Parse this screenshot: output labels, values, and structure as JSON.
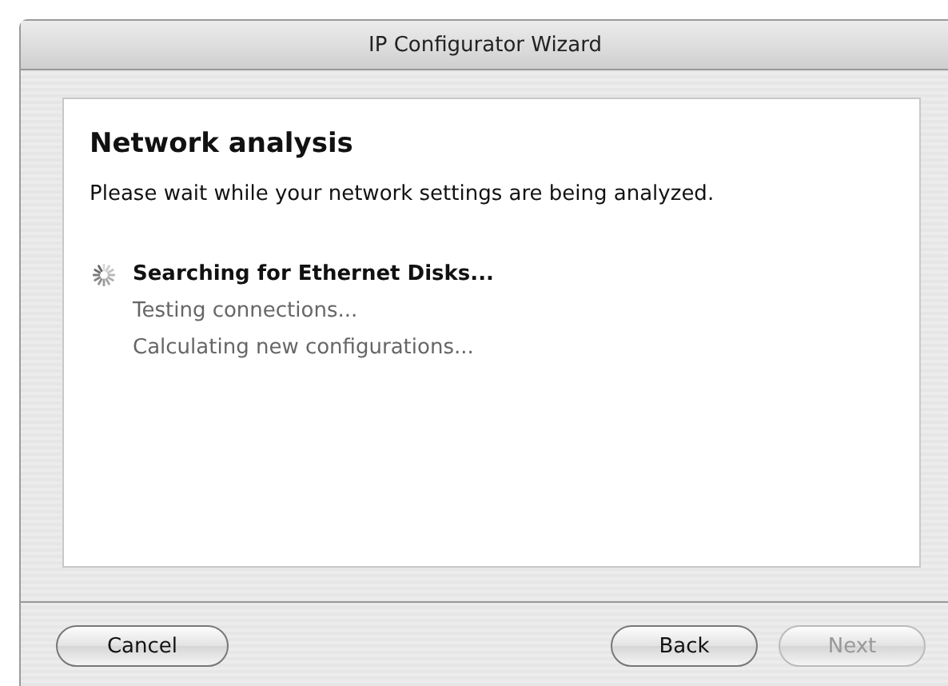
{
  "window": {
    "title": "IP Configurator Wizard"
  },
  "page": {
    "heading": "Network analysis",
    "description": "Please wait while your network settings are being analyzed."
  },
  "steps": [
    {
      "label": "Searching for Ethernet Disks...",
      "active": true
    },
    {
      "label": "Testing connections...",
      "active": false
    },
    {
      "label": "Calculating new configurations...",
      "active": false
    }
  ],
  "buttons": [
    {
      "label": "Cancel",
      "disabled": false,
      "kind": "left"
    },
    {
      "label": "Back",
      "disabled": false,
      "kind": "right"
    },
    {
      "label": "Next",
      "disabled": true,
      "kind": "right"
    }
  ]
}
